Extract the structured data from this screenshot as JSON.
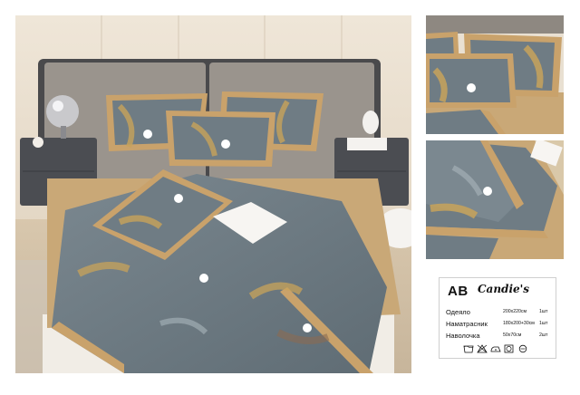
{
  "label": {
    "code": "AB",
    "brand": "Candie's",
    "items": [
      {
        "name": "Одеяло",
        "size": "200x220см",
        "qty": "1шт"
      },
      {
        "name": "Наматрасник",
        "size": "180x200+30см",
        "qty": "1шт"
      },
      {
        "name": "Наволочка",
        "size": "50x70см",
        "qty": "2шт"
      }
    ],
    "care_icons": [
      "wash-30-icon",
      "no-bleach-icon",
      "iron-low-icon",
      "tumble-dry-icon",
      "dry-clean-icon"
    ]
  },
  "colors": {
    "fabric_blue_gray": "#6f7c84",
    "trim_tan": "#c9a26b",
    "mattress_tan": "#c9a877",
    "headboard_gray": "#9a948d",
    "leaf_gold": "#c8a35a"
  }
}
